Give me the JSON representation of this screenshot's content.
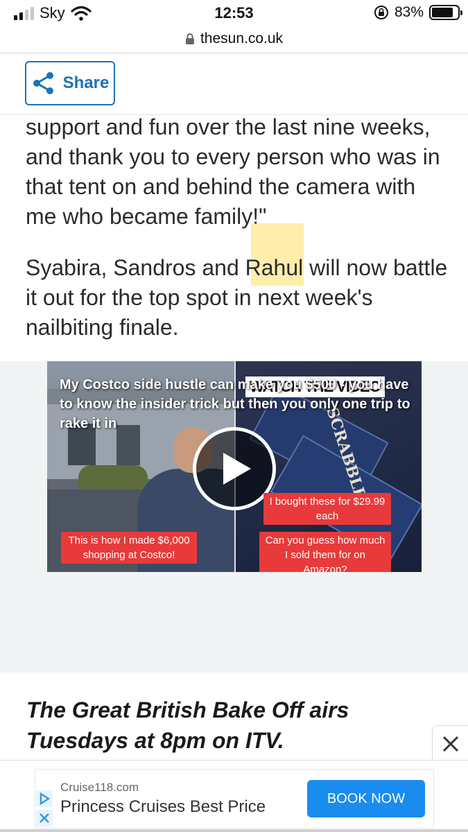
{
  "status_bar": {
    "carrier": "Sky",
    "time": "12:53",
    "battery_percent": "83%",
    "battery_level": 0.83,
    "signal_bars_active": 2,
    "signal_bars_total": 4
  },
  "browser": {
    "url": "thesun.co.uk"
  },
  "share": {
    "label": "Share"
  },
  "article": {
    "paragraph1": "support and fun over the last nine weeks, and thank you to every person who was in that tent on and behind the camera with me who became family!\"",
    "paragraph2": "Syabira, Sandros and Rahul will now battle it out for the top spot in next week's nailbiting finale.",
    "show_info": "The Great British Bake Off airs Tuesdays at 8pm on ITV."
  },
  "video": {
    "headline": "My Costco side hustle can make you $500 - you have to know the insider trick but then you only one trip to rake it in",
    "watch_badge": "WATCH THE VIDEO",
    "caption_top_right": "I bought these for $29.99 each",
    "caption_bottom_left": "This is how I made $6,000 shopping at Costco!",
    "caption_bottom_right": "Can you guess how much I sold them for on Amazon?",
    "scene_text": "SCRABBLE"
  },
  "ad": {
    "source": "Cruise118.com",
    "title": "Princess Cruises Best Price",
    "cta": "BOOK NOW"
  },
  "colors": {
    "share_blue": "#1a73b8",
    "highlight": "#ffd646",
    "caption_red": "#e83a3a",
    "cta_blue": "#1a8cf0"
  }
}
